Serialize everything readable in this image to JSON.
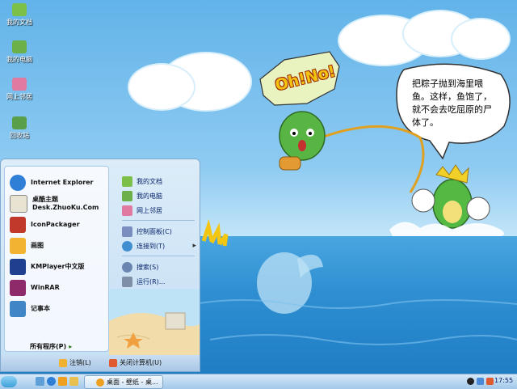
{
  "desktop": {
    "icons": [
      {
        "label": "我的文档",
        "icon": "folder-documents-icon",
        "color": "#7cc04a"
      },
      {
        "label": "我的电脑",
        "icon": "computer-icon",
        "color": "#6cb04a"
      },
      {
        "label": "网上邻居",
        "icon": "network-places-icon",
        "color": "#e07aa0"
      },
      {
        "label": "回收站",
        "icon": "recycle-bin-icon",
        "color": "#5aa04a"
      }
    ]
  },
  "wallpaper": {
    "exclamation": "Oh!No!",
    "speech_bubble": "把粽子抛到海里喂鱼。这样，鱼饱了，就不会去吃屈原的尸体了。"
  },
  "start_menu": {
    "pinned": [
      {
        "label": "Internet Explorer",
        "icon": "internet-explorer-icon",
        "color": "#2f7fd6"
      },
      {
        "label": "桌酷主题\nDesk.ZhuoKu.Com",
        "icon": "zhuoku-theme-icon",
        "color": "#e9e4d2"
      },
      {
        "label": "IconPackager",
        "icon": "iconpackager-icon",
        "color": "#c0392b"
      },
      {
        "label": "画图",
        "icon": "paint-icon",
        "color": "#f2b232"
      },
      {
        "label": "KMPlayer中文版",
        "icon": "kmplayer-icon",
        "color": "#1f3f8f"
      },
      {
        "label": "WinRAR",
        "icon": "winrar-icon",
        "color": "#8e2a6a"
      },
      {
        "label": "记事本",
        "icon": "notepad-icon",
        "color": "#3f86c7"
      }
    ],
    "all_programs": "所有程序(P)",
    "right": [
      {
        "label": "我的文档",
        "icon": "my-documents-icon",
        "color": "#7cc04a"
      },
      {
        "label": "我的电脑",
        "icon": "my-computer-icon",
        "color": "#6cb04a"
      },
      {
        "label": "网上邻居",
        "icon": "network-icon",
        "color": "#e07aa0"
      },
      {
        "label": "控制面板(C)",
        "icon": "control-panel-icon",
        "color": "#7a8fc0"
      },
      {
        "label": "连接到(T)",
        "icon": "connect-to-icon",
        "color": "#3f8fd0",
        "submenu": "▸"
      },
      {
        "label": "搜索(S)",
        "icon": "search-icon",
        "color": "#6a86b0"
      },
      {
        "label": "运行(R)...",
        "icon": "run-icon",
        "color": "#7f8fa8"
      }
    ],
    "logoff": "注销(L)",
    "shutdown": "关闭计算机(U)"
  },
  "taskbar": {
    "task_label": "桌面 - 壁纸 - 桌...",
    "clock": "17:55"
  }
}
